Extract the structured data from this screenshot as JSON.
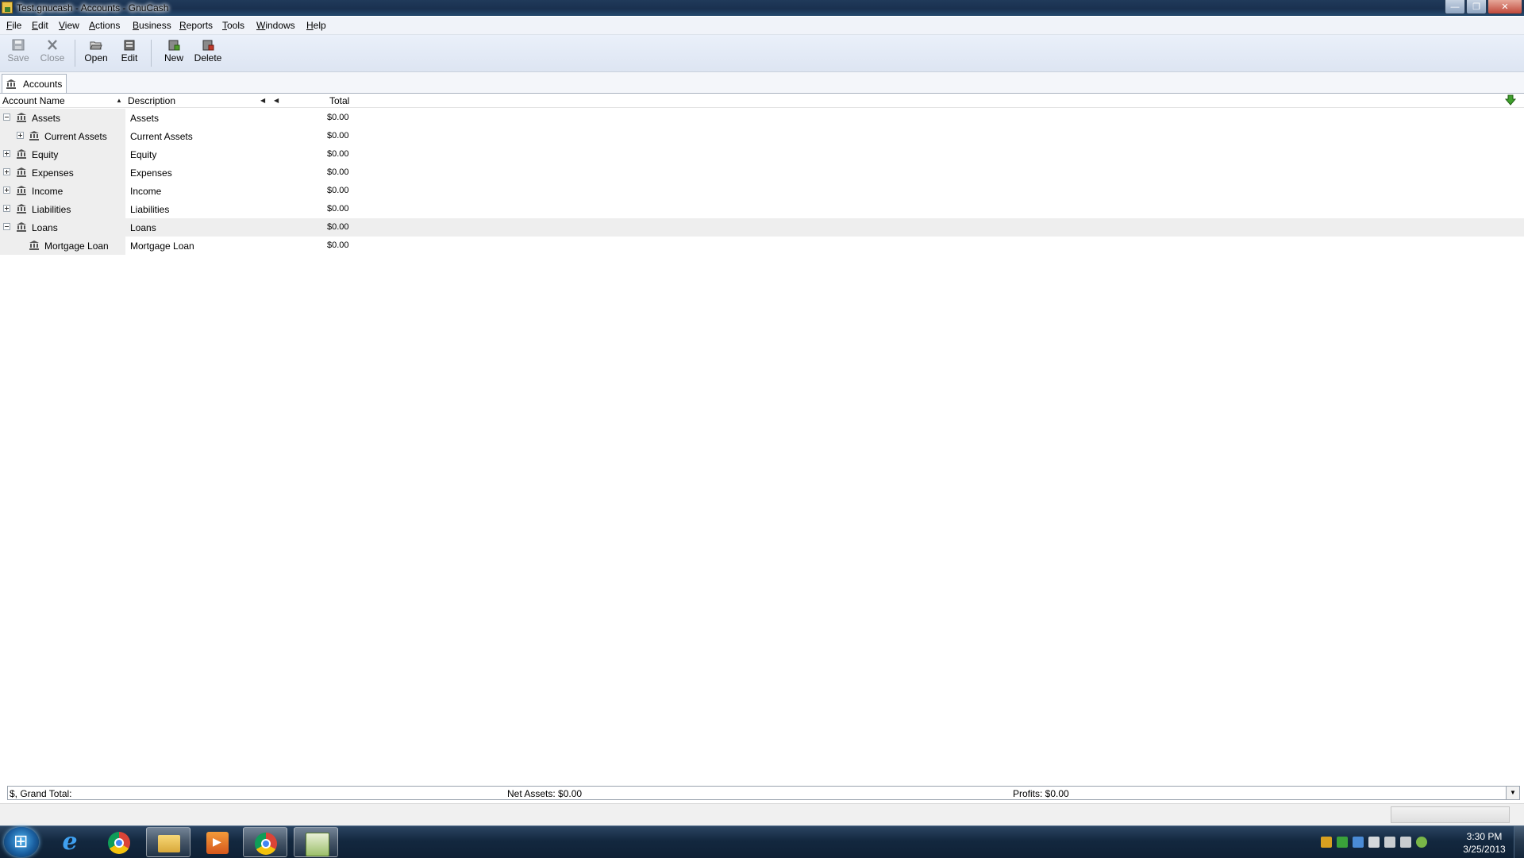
{
  "window": {
    "title": "Test.gnucash - Accounts - GnuCash",
    "controls": {
      "minimize": "—",
      "maximize": "❐",
      "close": "✕"
    }
  },
  "menubar": [
    "File",
    "Edit",
    "View",
    "Actions",
    "Business",
    "Reports",
    "Tools",
    "Windows",
    "Help"
  ],
  "toolbar": {
    "save": "Save",
    "close": "Close",
    "open": "Open",
    "edit": "Edit",
    "new": "New",
    "delete": "Delete"
  },
  "tab": {
    "label": "Accounts",
    "icon": "bank-icon"
  },
  "columns": {
    "name": "Account Name",
    "description": "Description",
    "total": "Total"
  },
  "accounts": [
    {
      "name": "Assets",
      "description": "Assets",
      "total": "$0.00",
      "level": 0,
      "expander": "minus"
    },
    {
      "name": "Current Assets",
      "description": "Current Assets",
      "total": "$0.00",
      "level": 1,
      "expander": "plus"
    },
    {
      "name": "Equity",
      "description": "Equity",
      "total": "$0.00",
      "level": 0,
      "expander": "plus"
    },
    {
      "name": "Expenses",
      "description": "Expenses",
      "total": "$0.00",
      "level": 0,
      "expander": "plus"
    },
    {
      "name": "Income",
      "description": "Income",
      "total": "$0.00",
      "level": 0,
      "expander": "plus"
    },
    {
      "name": "Liabilities",
      "description": "Liabilities",
      "total": "$0.00",
      "level": 0,
      "expander": "plus"
    },
    {
      "name": "Loans",
      "description": "Loans",
      "total": "$0.00",
      "level": 0,
      "expander": "minus",
      "selected": true
    },
    {
      "name": "Mortgage Loan",
      "description": "Mortgage Loan",
      "total": "$0.00",
      "level": 1,
      "expander": "none"
    }
  ],
  "summary": {
    "grand_total": "$, Grand Total:",
    "net_assets": "Net Assets: $0.00",
    "profits": "Profits: $0.00"
  },
  "taskbar": {
    "apps": [
      "start-button",
      "internet-explorer-icon",
      "chrome-icon",
      "windows-explorer-icon",
      "media-player-icon",
      "chrome-icon",
      "gnucash-icon"
    ],
    "clock_time": "3:30 PM",
    "clock_date": "3/25/2013"
  },
  "colors": {
    "title_bar": "#1a3150",
    "menubar": "#f0f3f9",
    "toolbar": "#dde5f2",
    "selected_row": "#eeeeee",
    "taskbar": "#13283f"
  }
}
